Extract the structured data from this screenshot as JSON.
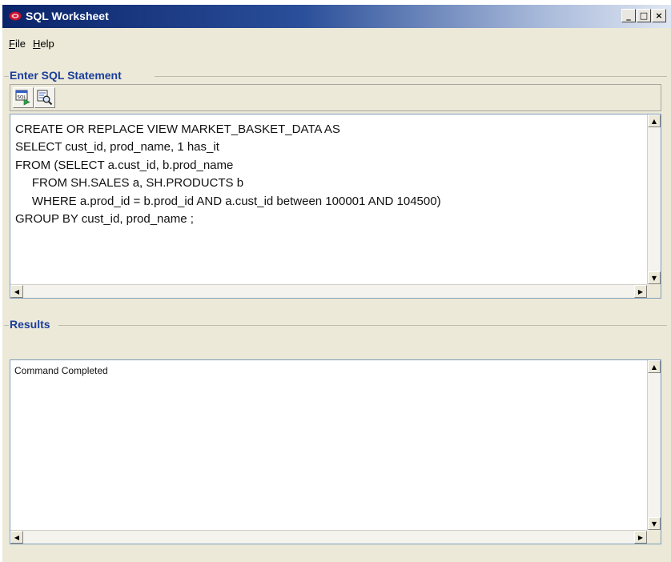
{
  "window": {
    "title": "SQL Worksheet",
    "controls": {
      "minimize": "_",
      "maximize": "□",
      "close": "×"
    }
  },
  "menu": [
    {
      "label": "File",
      "mnemonic": "F",
      "rest": "ile"
    },
    {
      "label": "Help",
      "mnemonic": "H",
      "rest": "elp"
    }
  ],
  "sql_section": {
    "title": "Enter SQL Statement",
    "toolbar": [
      {
        "icon": "execute-sql-icon",
        "tooltip": ""
      },
      {
        "icon": "explain-plan-icon",
        "tooltip": ""
      }
    ],
    "statement": "CREATE OR REPLACE VIEW MARKET_BASKET_DATA AS\nSELECT cust_id, prod_name, 1 has_it\nFROM (SELECT a.cust_id, b.prod_name\n     FROM SH.SALES a, SH.PRODUCTS b\n     WHERE a.prod_id = b.prod_id AND a.cust_id between 100001 AND 104500)\nGROUP BY cust_id, prod_name ;"
  },
  "results_section": {
    "title": "Results",
    "output": "Command Completed"
  },
  "colors": {
    "accent": "#1a3e9c",
    "titlebar_start": "#0a246a",
    "window_bg": "#ece9d8"
  }
}
